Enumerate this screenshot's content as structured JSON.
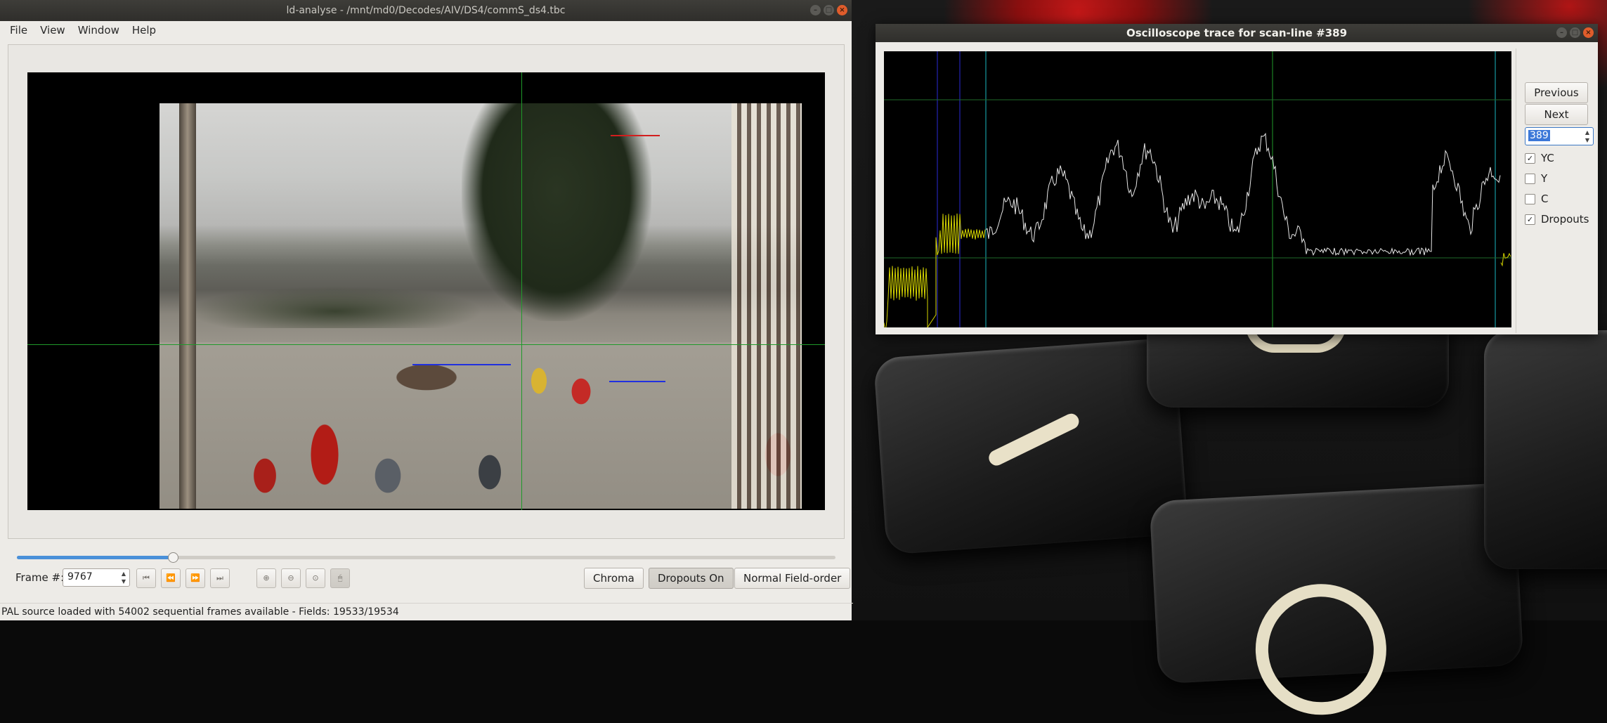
{
  "main_window": {
    "title": "ld-analyse - /mnt/md0/Decodes/AIV/DS4/commS_ds4.tbc",
    "menu": [
      "File",
      "View",
      "Window",
      "Help"
    ],
    "frame_label": "Frame #:",
    "frame_value": "9767",
    "scrub_position": 0.19,
    "buttons": {
      "chroma": "Chroma",
      "dropouts": "Dropouts On",
      "field_order": "Normal Field-order"
    },
    "status_text": "PAL source loaded with 54002 sequential frames available  -  Fields: 19533/19534"
  },
  "window_buttons": {
    "minimize": "–",
    "maximize": "□",
    "close": "×"
  },
  "scope_window": {
    "title": "Oscilloscope trace for scan-line #389",
    "previous_label": "Previous",
    "next_label": "Next",
    "scan_line": "389",
    "checkboxes": [
      {
        "label": "YC",
        "checked": true
      },
      {
        "label": "Y",
        "checked": false
      },
      {
        "label": "C",
        "checked": false
      },
      {
        "label": "Dropouts",
        "checked": true
      }
    ]
  },
  "colors": {
    "trace_luma": "#e6e6e6",
    "trace_sync": "#d4d400",
    "marker_blue": "#2a2ad8",
    "marker_cyan": "#1ab6c0",
    "marker_green": "#1f9a2a",
    "dropout_red": "#d21e1e",
    "dropout_blue": "#2030e0"
  }
}
